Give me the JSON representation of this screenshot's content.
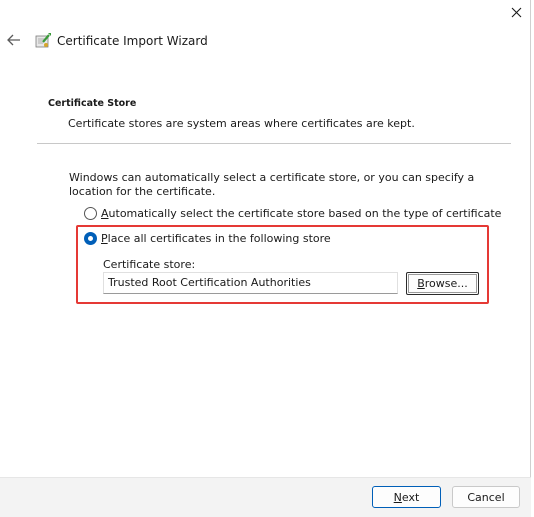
{
  "window": {
    "title": "Certificate Import Wizard",
    "close_label": "×"
  },
  "section": {
    "title": "Certificate Store",
    "description": "Certificate stores are system areas where certificates are kept."
  },
  "intro": "Windows can automatically select a certificate store, or you can specify a location for the certificate.",
  "options": {
    "auto": {
      "accel": "A",
      "rest": "utomatically select the certificate store based on the type of certificate",
      "checked": false
    },
    "place": {
      "accel": "P",
      "rest": "lace all certificates in the following store",
      "checked": true
    }
  },
  "store": {
    "label": "Certificate store:",
    "value": "Trusted Root Certification Authorities",
    "browse_accel": "B",
    "browse_rest": "rowse..."
  },
  "footer": {
    "next_accel": "N",
    "next_rest": "ext",
    "cancel_label": "Cancel"
  },
  "colors": {
    "accent": "#005fb8",
    "highlight": "#e53935"
  }
}
